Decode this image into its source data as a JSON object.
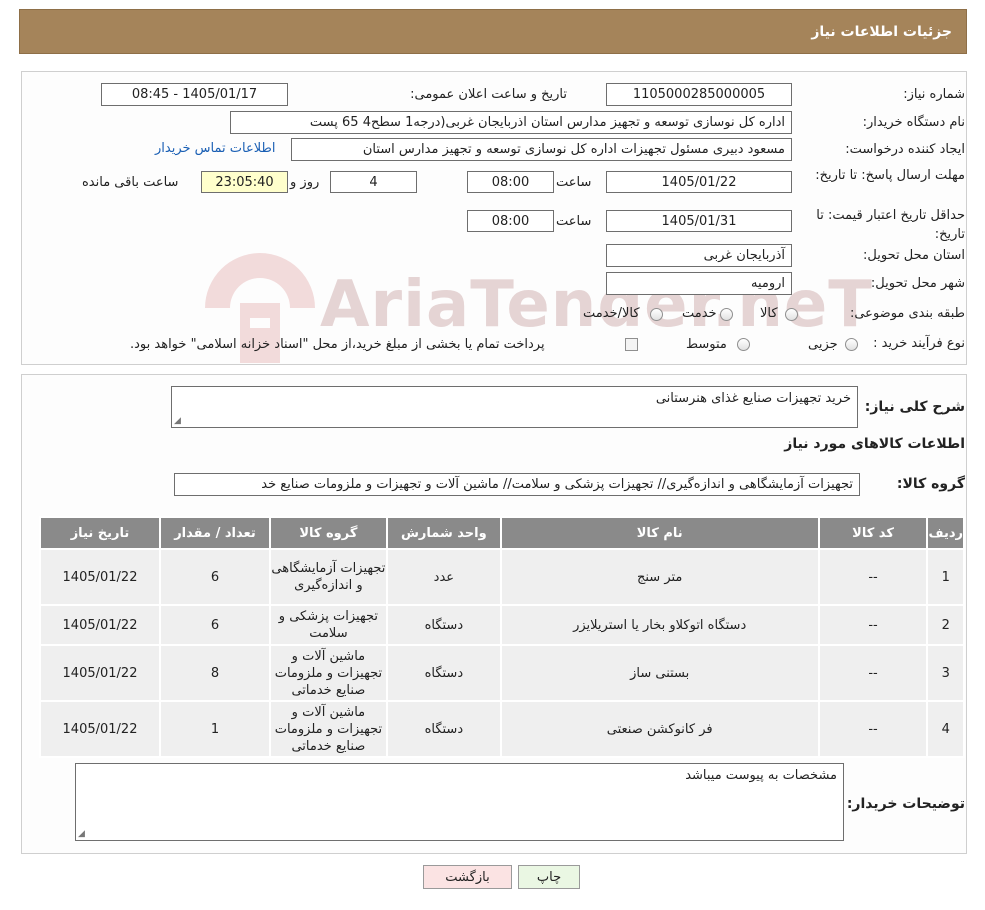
{
  "header": {
    "title": "جزئیات اطلاعات نیاز"
  },
  "watermark": {
    "text": "AriaTender.neT"
  },
  "form": {
    "need_number_label": "شماره نیاز:",
    "need_number": "1105000285000005",
    "announce_label": "تاریخ و ساعت اعلان عمومی:",
    "announce_value": "1405/01/17 - 08:45",
    "buyer_org_label": "نام دستگاه خریدار:",
    "buyer_org": "اداره کل نوسازی   توسعه و تجهیز مدارس استان اذربایجان غربی(درجه1  سطح4  65 پست",
    "creator_label": "ایجاد کننده درخواست:",
    "creator": "مسعود دبیری مسئول تجهیزات اداره کل نوسازی   توسعه و تجهیز مدارس استان",
    "contact_link": "اطلاعات تماس خریدار",
    "deadline_label": "مهلت ارسال پاسخ: تا تاریخ:",
    "deadline_date": "1405/01/22",
    "time_label": "ساعت",
    "deadline_time": "08:00",
    "days_value": "4",
    "days_label": "روز و",
    "remaining_time": "23:05:40",
    "remaining_label": "ساعت باقی مانده",
    "price_validity_label": "حداقل تاریخ اعتبار قیمت: تا تاریخ:",
    "price_validity_date": "1405/01/31",
    "price_validity_time": "08:00",
    "province_label": "استان محل تحویل:",
    "province": "آذربایجان غربی",
    "city_label": "شهر محل تحویل:",
    "city": "ارومیه",
    "category_label": "طبقه بندی موضوعی:",
    "category_options": [
      "کالا",
      "خدمت",
      "کالا/خدمت"
    ],
    "process_label": "نوع فرآیند خرید :",
    "process_options": [
      "جزیی",
      "متوسط"
    ],
    "process_note": "پرداخت تمام یا بخشی از مبلغ خرید،از محل \"اسناد خزانه اسلامی\" خواهد بود."
  },
  "summary": {
    "desc_label": "شرح کلی نیاز:",
    "desc_value": "خرید تجهیزات صنایع غذای هنرستانی",
    "items_title": "اطلاعات کالاهای مورد نیاز",
    "group_label": "گروه کالا:",
    "group_value": "تجهیزات آزمایشگاهی و اندازه‌گیری// تجهیزات پزشکی و سلامت// ماشین آلات و تجهیزات و ملزومات صنایع خد"
  },
  "table": {
    "headers": [
      "ردیف",
      "کد کالا",
      "نام کالا",
      "واحد شمارش",
      "گروه کالا",
      "تعداد / مقدار",
      "تاریخ نیاز"
    ],
    "rows": [
      {
        "row": "1",
        "code": "--",
        "name": "متر سنج",
        "unit": "عدد",
        "group": "تجهیزات آزمایشگاهی و اندازه‌گیری",
        "qty": "6",
        "date": "1405/01/22"
      },
      {
        "row": "2",
        "code": "--",
        "name": "دستگاه اتوکلاو بخار یا استریلایزر",
        "unit": "دستگاه",
        "group": "تجهیزات پزشکی و سلامت",
        "qty": "6",
        "date": "1405/01/22"
      },
      {
        "row": "3",
        "code": "--",
        "name": "بستنی ساز",
        "unit": "دستگاه",
        "group": "ماشین آلات و تجهیزات و ملزومات صنایع خدماتی",
        "qty": "8",
        "date": "1405/01/22"
      },
      {
        "row": "4",
        "code": "--",
        "name": "فر کانوکشن صنعتی",
        "unit": "دستگاه",
        "group": "ماشین آلات و تجهیزات و ملزومات صنایع خدماتی",
        "qty": "1",
        "date": "1405/01/22"
      }
    ]
  },
  "buyer_notes": {
    "label": "توضیحات خریدار:",
    "value": "مشخصات به پیوست میباشد"
  },
  "buttons": {
    "print": "چاپ",
    "back": "بازگشت"
  }
}
